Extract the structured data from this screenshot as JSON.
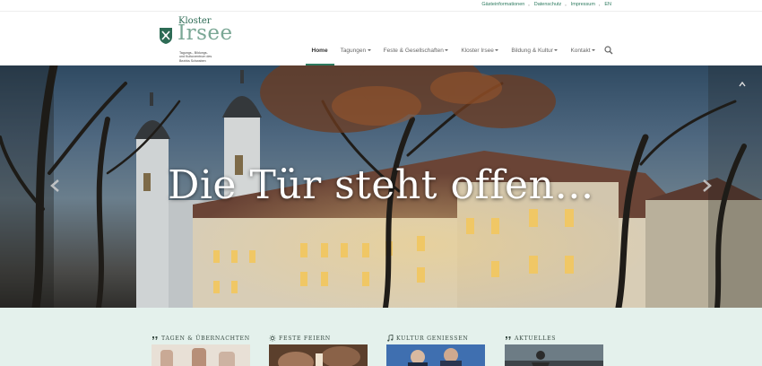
{
  "topbar": {
    "links": [
      {
        "label": "Gästeinformationen"
      },
      {
        "label": "Datenschutz"
      },
      {
        "label": "Impressum"
      },
      {
        "label": "EN"
      }
    ]
  },
  "logo": {
    "line1": "Kloster",
    "line2": "Irsee",
    "tagline_1": "Tagungs-, Bildungs-",
    "tagline_2": "und Kulturzentrum des",
    "tagline_3": "Bezirks Schwaben"
  },
  "nav": {
    "items": [
      {
        "label": "Home",
        "active": true
      },
      {
        "label": "Tagungen",
        "dropdown": true
      },
      {
        "label": "Feste & Gesellschaften",
        "dropdown": true
      },
      {
        "label": "Kloster Irsee",
        "dropdown": true
      },
      {
        "label": "Bildung & Kultur",
        "dropdown": true
      },
      {
        "label": "Kontakt",
        "dropdown": true
      }
    ],
    "search_icon": "search-icon"
  },
  "hero": {
    "headline": "Die Tür steht offen…"
  },
  "cards": [
    {
      "title": "Tagen & Übernachten",
      "icon": "quote-icon"
    },
    {
      "title": "Feste feiern",
      "icon": "sun-icon"
    },
    {
      "title": "Kultur geniessen",
      "icon": "music-note-icon"
    },
    {
      "title": "Aktuelles",
      "icon": "quote-icon"
    }
  ],
  "colors": {
    "accent": "#2d7a5f",
    "logo_light": "#7aa795",
    "section_bg": "#e4f1ec"
  }
}
